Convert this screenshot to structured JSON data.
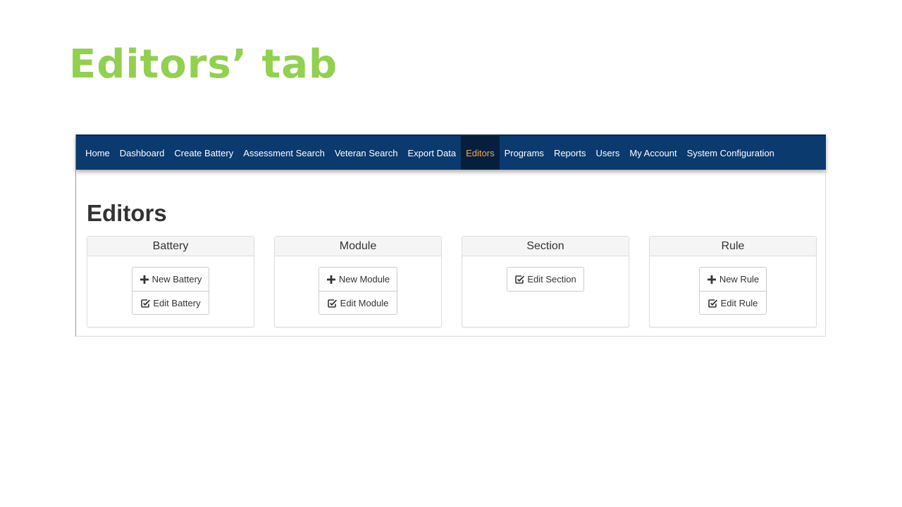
{
  "slide": {
    "title": "Editors’ tab"
  },
  "navbar": {
    "items": [
      {
        "label": "Home",
        "active": false
      },
      {
        "label": "Dashboard",
        "active": false
      },
      {
        "label": "Create Battery",
        "active": false
      },
      {
        "label": "Assessment Search",
        "active": false
      },
      {
        "label": "Veteran Search",
        "active": false
      },
      {
        "label": "Export Data",
        "active": false
      },
      {
        "label": "Editors",
        "active": true
      },
      {
        "label": "Programs",
        "active": false
      },
      {
        "label": "Reports",
        "active": false
      },
      {
        "label": "Users",
        "active": false
      },
      {
        "label": "My Account",
        "active": false
      },
      {
        "label": "System Configuration",
        "active": false
      }
    ]
  },
  "page": {
    "heading": "Editors"
  },
  "panels": [
    {
      "title": "Battery",
      "buttons": [
        {
          "label": "New Battery",
          "icon": "plus-icon"
        },
        {
          "label": "Edit Battery",
          "icon": "edit-icon"
        }
      ]
    },
    {
      "title": "Module",
      "buttons": [
        {
          "label": "New Module",
          "icon": "plus-icon"
        },
        {
          "label": "Edit Module",
          "icon": "edit-icon"
        }
      ]
    },
    {
      "title": "Section",
      "buttons": [
        {
          "label": "Edit Section",
          "icon": "edit-icon"
        }
      ]
    },
    {
      "title": "Rule",
      "buttons": [
        {
          "label": "New Rule",
          "icon": "plus-icon"
        },
        {
          "label": "Edit Rule",
          "icon": "edit-icon"
        }
      ]
    }
  ],
  "colors": {
    "title_green": "#92d050",
    "navbar_bg": "#0a3a6e",
    "navbar_active_bg": "#061f3d",
    "navbar_active_text": "#f0ad4e",
    "heading_text": "#333333"
  }
}
